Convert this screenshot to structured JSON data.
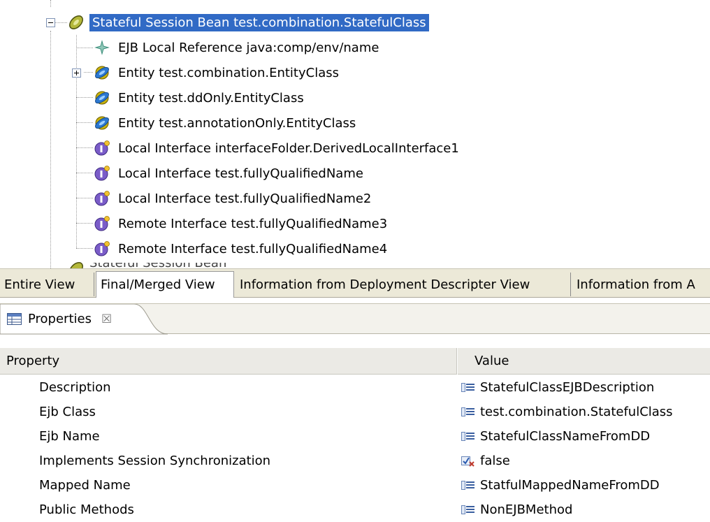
{
  "tree": {
    "root": {
      "label": "Stateful Session Bean test.combination.StatefulClass",
      "icon": "session-bean-icon",
      "expanded": true,
      "selected": true
    },
    "children": [
      {
        "label": "EJB Local Reference java:comp/env/name",
        "icon": "ejb-reference-icon"
      },
      {
        "label": "Entity test.combination.EntityClass",
        "icon": "entity-bean-icon",
        "expandable": true
      },
      {
        "label": "Entity test.ddOnly.EntityClass",
        "icon": "entity-bean-icon"
      },
      {
        "label": "Entity test.annotationOnly.EntityClass",
        "icon": "entity-bean-icon"
      },
      {
        "label": "Local Interface interfaceFolder.DerivedLocalInterface1",
        "icon": "interface-icon"
      },
      {
        "label": "Local Interface test.fullyQualifiedName",
        "icon": "interface-icon"
      },
      {
        "label": "Local Interface test.fullyQualifiedName2",
        "icon": "interface-icon"
      },
      {
        "label": "Remote Interface test.fullyQualifiedName3",
        "icon": "interface-icon"
      },
      {
        "label": "Remote Interface test.fullyQualifiedName4",
        "icon": "interface-icon"
      }
    ],
    "partial_next_label": "Stateful Session Bean test.ddOnly.StatefulClass"
  },
  "view_tabs": [
    {
      "label": "Entire View",
      "active": false
    },
    {
      "label": "Final/Merged View",
      "active": true
    },
    {
      "label": "Information from Deployment Descripter View",
      "active": false
    },
    {
      "label": "Information from A",
      "active": false
    }
  ],
  "properties_view": {
    "tab_label": "Properties",
    "close_symbol": "☒",
    "columns": {
      "property": "Property",
      "value": "Value"
    },
    "rows": [
      {
        "name": "Description",
        "value": "StatefulClassEJBDescription",
        "value_icon": "text-value-icon"
      },
      {
        "name": "Ejb Class",
        "value": "test.combination.StatefulClass",
        "value_icon": "text-value-icon"
      },
      {
        "name": "Ejb Name",
        "value": "StatefulClassNameFromDD",
        "value_icon": "text-value-icon"
      },
      {
        "name": "Implements Session Synchronization",
        "value": "false",
        "value_icon": "boolean-value-icon"
      },
      {
        "name": "Mapped Name",
        "value": "StatfulMappedNameFromDD",
        "value_icon": "text-value-icon"
      },
      {
        "name": "Public Methods",
        "value": "NonEJBMethod",
        "value_icon": "text-value-icon"
      }
    ]
  },
  "colors": {
    "selection": "#316ac5",
    "tab_bar": "#ece9d8",
    "header": "#ebeae5"
  }
}
